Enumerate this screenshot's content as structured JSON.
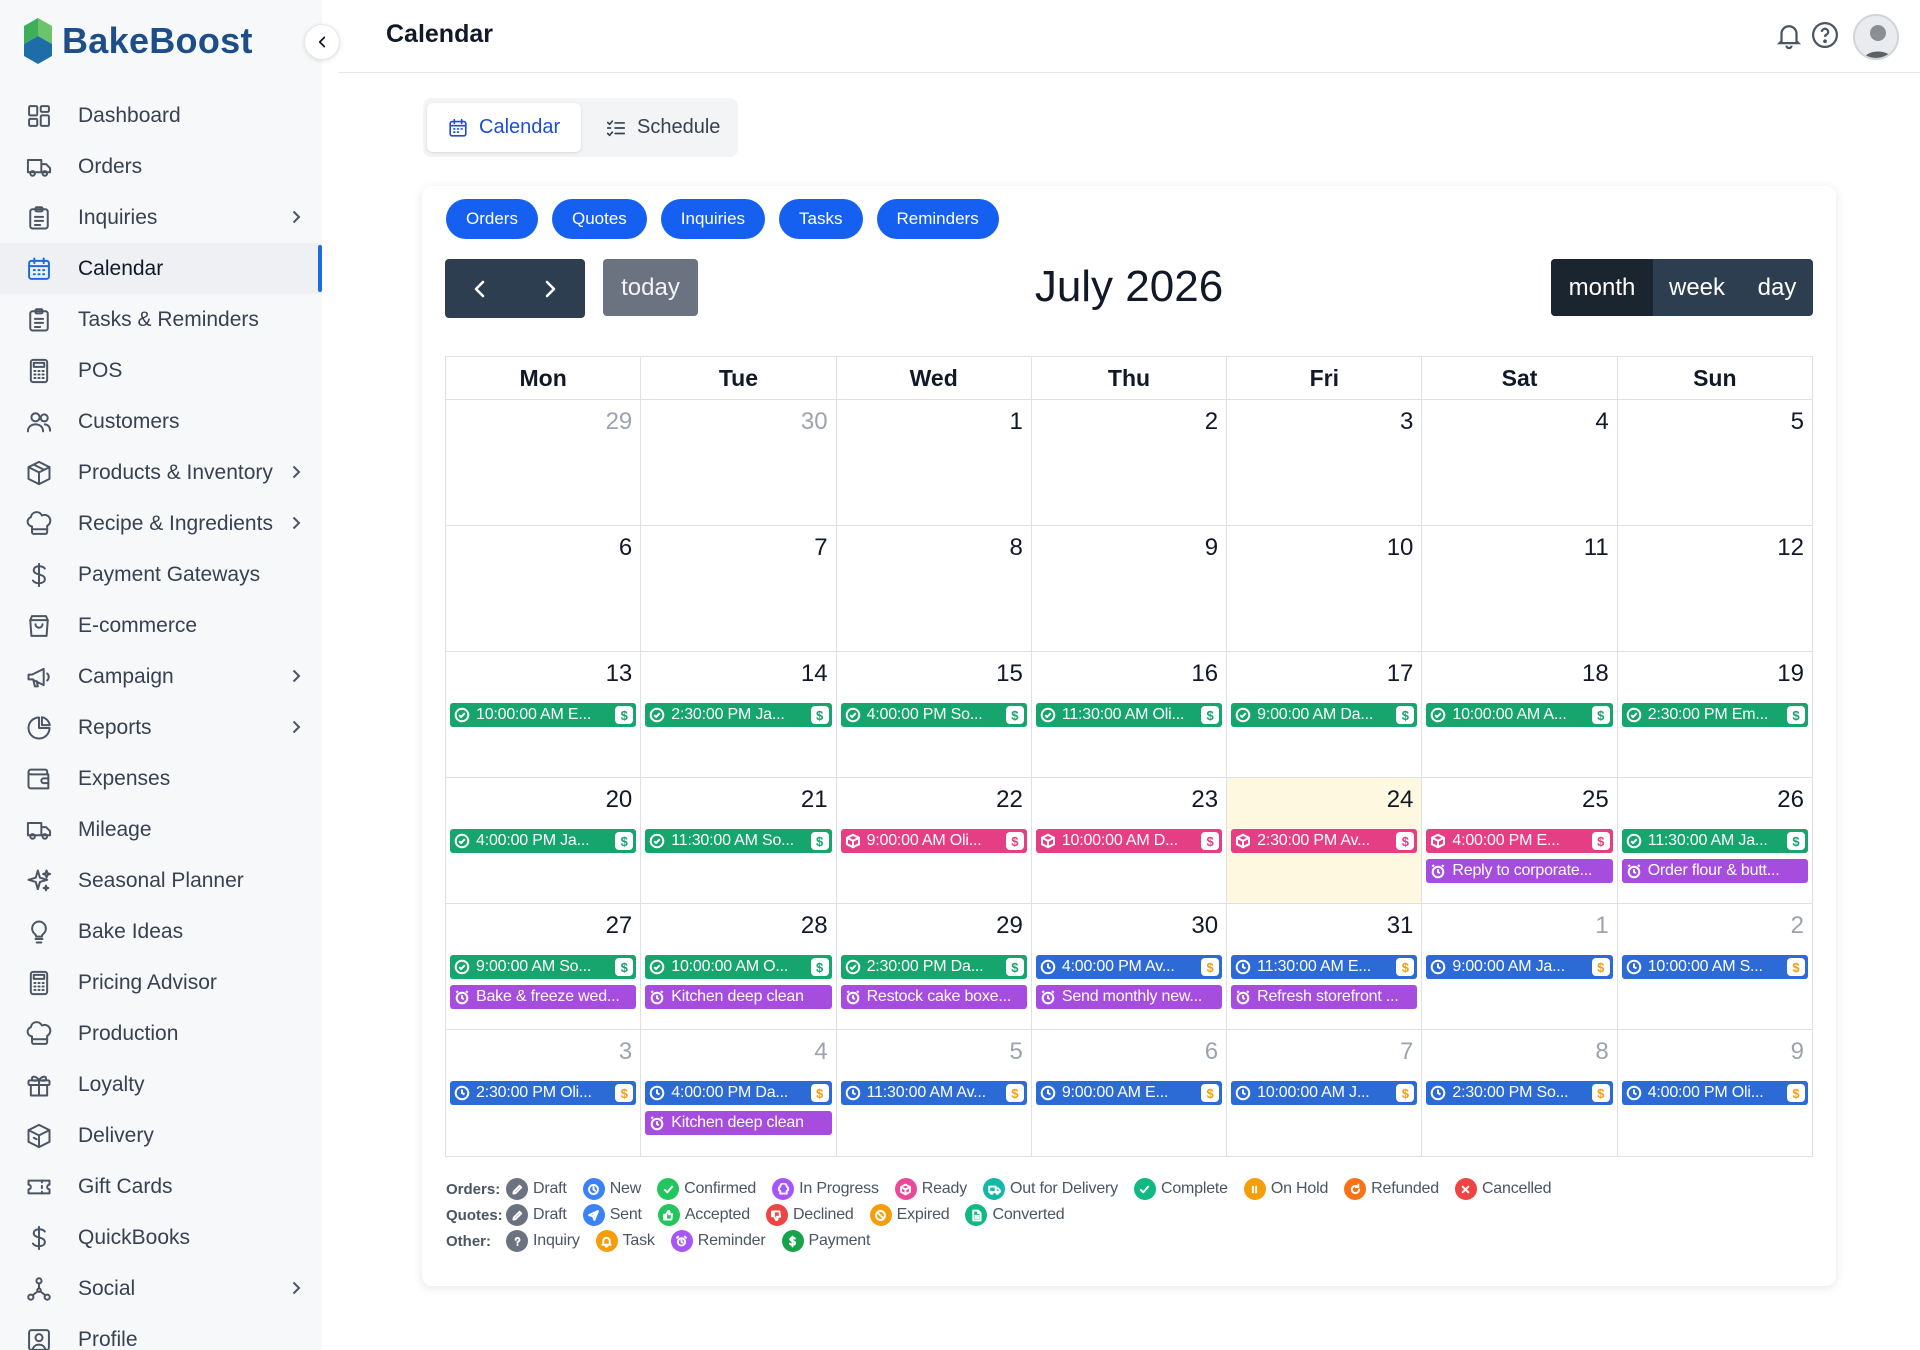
{
  "brand": {
    "name": "BakeBoost"
  },
  "header": {
    "title": "Calendar"
  },
  "sidebar": {
    "items": [
      {
        "label": "Dashboard",
        "icon": "dashboard-icon",
        "chevron": false
      },
      {
        "label": "Orders",
        "icon": "truck-icon",
        "chevron": false
      },
      {
        "label": "Inquiries",
        "icon": "clipboard-icon",
        "chevron": true
      },
      {
        "label": "Calendar",
        "icon": "calendar-icon",
        "chevron": false,
        "active": true
      },
      {
        "label": "Tasks & Reminders",
        "icon": "clipboard-icon",
        "chevron": false
      },
      {
        "label": "POS",
        "icon": "calculator-icon",
        "chevron": false
      },
      {
        "label": "Customers",
        "icon": "users-icon",
        "chevron": false
      },
      {
        "label": "Products & Inventory",
        "icon": "box-icon",
        "chevron": true
      },
      {
        "label": "Recipe & Ingredients",
        "icon": "chef-hat-icon",
        "chevron": true
      },
      {
        "label": "Payment Gateways",
        "icon": "dollar-icon",
        "chevron": false
      },
      {
        "label": "E-commerce",
        "icon": "shopping-bag-icon",
        "chevron": false
      },
      {
        "label": "Campaign",
        "icon": "megaphone-icon",
        "chevron": true
      },
      {
        "label": "Reports",
        "icon": "pie-chart-icon",
        "chevron": true
      },
      {
        "label": "Expenses",
        "icon": "wallet-icon",
        "chevron": false
      },
      {
        "label": "Mileage",
        "icon": "truck-icon",
        "chevron": false
      },
      {
        "label": "Seasonal Planner",
        "icon": "sparkles-icon",
        "chevron": false
      },
      {
        "label": "Bake Ideas",
        "icon": "lightbulb-icon",
        "chevron": false
      },
      {
        "label": "Pricing Advisor",
        "icon": "calculator-icon",
        "chevron": false
      },
      {
        "label": "Production",
        "icon": "chef-hat-icon",
        "chevron": false
      },
      {
        "label": "Loyalty",
        "icon": "gift-icon",
        "chevron": false
      },
      {
        "label": "Delivery",
        "icon": "package-icon",
        "chevron": false
      },
      {
        "label": "Gift Cards",
        "icon": "ticket-icon",
        "chevron": false
      },
      {
        "label": "QuickBooks",
        "icon": "dollar-icon",
        "chevron": false
      },
      {
        "label": "Social",
        "icon": "network-icon",
        "chevron": true
      },
      {
        "label": "Profile",
        "icon": "profile-icon",
        "chevron": false
      }
    ]
  },
  "view_tabs": {
    "calendar": "Calendar",
    "schedule": "Schedule"
  },
  "filters": [
    "Orders",
    "Quotes",
    "Inquiries",
    "Tasks",
    "Reminders"
  ],
  "toolbar": {
    "today": "today",
    "title": "July 2026",
    "month": "month",
    "week": "week",
    "day": "day"
  },
  "weekdays": [
    "Mon",
    "Tue",
    "Wed",
    "Thu",
    "Fri",
    "Sat",
    "Sun"
  ],
  "weeks": [
    [
      {
        "n": "29",
        "other": true,
        "events": []
      },
      {
        "n": "30",
        "other": true,
        "events": []
      },
      {
        "n": "1",
        "events": []
      },
      {
        "n": "2",
        "events": []
      },
      {
        "n": "3",
        "events": []
      },
      {
        "n": "4",
        "events": []
      },
      {
        "n": "5",
        "events": []
      }
    ],
    [
      {
        "n": "6",
        "events": []
      },
      {
        "n": "7",
        "events": []
      },
      {
        "n": "8",
        "events": []
      },
      {
        "n": "9",
        "events": []
      },
      {
        "n": "10",
        "events": []
      },
      {
        "n": "11",
        "events": []
      },
      {
        "n": "12",
        "events": []
      }
    ],
    [
      {
        "n": "13",
        "events": [
          {
            "text": "10:00:00 AM E...",
            "color": "green",
            "icon": "check-circle-icon",
            "pay": true
          }
        ]
      },
      {
        "n": "14",
        "events": [
          {
            "text": "2:30:00 PM Ja...",
            "color": "green",
            "icon": "check-circle-icon",
            "pay": true
          }
        ]
      },
      {
        "n": "15",
        "events": [
          {
            "text": "4:00:00 PM So...",
            "color": "green",
            "icon": "check-circle-icon",
            "pay": true
          }
        ]
      },
      {
        "n": "16",
        "events": [
          {
            "text": "11:30:00 AM Oli...",
            "color": "green",
            "icon": "check-circle-icon",
            "pay": true
          }
        ]
      },
      {
        "n": "17",
        "events": [
          {
            "text": "9:00:00 AM Da...",
            "color": "green",
            "icon": "check-circle-icon",
            "pay": true
          }
        ]
      },
      {
        "n": "18",
        "events": [
          {
            "text": "10:00:00 AM A...",
            "color": "green",
            "icon": "check-circle-icon",
            "pay": true
          }
        ]
      },
      {
        "n": "19",
        "events": [
          {
            "text": "2:30:00 PM Em...",
            "color": "green",
            "icon": "check-circle-icon",
            "pay": true
          }
        ]
      }
    ],
    [
      {
        "n": "20",
        "events": [
          {
            "text": "4:00:00 PM Ja...",
            "color": "green",
            "icon": "check-circle-icon",
            "pay": true
          }
        ]
      },
      {
        "n": "21",
        "events": [
          {
            "text": "11:30:00 AM So...",
            "color": "green",
            "icon": "check-circle-icon",
            "pay": true
          }
        ]
      },
      {
        "n": "22",
        "events": [
          {
            "text": "9:00:00 AM Oli...",
            "color": "pink",
            "icon": "box-icon",
            "pay": true
          }
        ]
      },
      {
        "n": "23",
        "events": [
          {
            "text": "10:00:00 AM D...",
            "color": "pink",
            "icon": "box-icon",
            "pay": true
          }
        ]
      },
      {
        "n": "24",
        "today": true,
        "events": [
          {
            "text": "2:30:00 PM Av...",
            "color": "pink",
            "icon": "box-icon",
            "pay": true
          }
        ]
      },
      {
        "n": "25",
        "events": [
          {
            "text": "4:00:00 PM E...",
            "color": "pink",
            "icon": "box-icon",
            "pay": true
          },
          {
            "text": "Reply to corporate...",
            "color": "purple",
            "icon": "alarm-icon",
            "pay": false
          }
        ]
      },
      {
        "n": "26",
        "events": [
          {
            "text": "11:30:00 AM Ja...",
            "color": "green",
            "icon": "check-circle-icon",
            "pay": true
          },
          {
            "text": "Order flour & butt...",
            "color": "purple",
            "icon": "alarm-icon",
            "pay": false
          }
        ]
      }
    ],
    [
      {
        "n": "27",
        "events": [
          {
            "text": "9:00:00 AM So...",
            "color": "green",
            "icon": "check-circle-icon",
            "pay": true
          },
          {
            "text": "Bake & freeze wed...",
            "color": "purple",
            "icon": "alarm-icon",
            "pay": false
          }
        ]
      },
      {
        "n": "28",
        "events": [
          {
            "text": "10:00:00 AM O...",
            "color": "green",
            "icon": "check-circle-icon",
            "pay": true
          },
          {
            "text": "Kitchen deep clean",
            "color": "purple",
            "icon": "alarm-icon",
            "pay": false
          }
        ]
      },
      {
        "n": "29",
        "events": [
          {
            "text": "2:30:00 PM Da...",
            "color": "green",
            "icon": "check-circle-icon",
            "pay": true
          },
          {
            "text": "Restock cake boxe...",
            "color": "purple",
            "icon": "alarm-icon",
            "pay": false
          }
        ]
      },
      {
        "n": "30",
        "events": [
          {
            "text": "4:00:00 PM Av...",
            "color": "blue",
            "icon": "clock-icon",
            "pay": true
          },
          {
            "text": "Send monthly new...",
            "color": "purple",
            "icon": "alarm-icon",
            "pay": false
          }
        ]
      },
      {
        "n": "31",
        "events": [
          {
            "text": "11:30:00 AM E...",
            "color": "blue",
            "icon": "clock-icon",
            "pay": true
          },
          {
            "text": "Refresh storefront ...",
            "color": "purple",
            "icon": "alarm-icon",
            "pay": false
          }
        ]
      },
      {
        "n": "1",
        "other": true,
        "events": [
          {
            "text": "9:00:00 AM Ja...",
            "color": "blue",
            "icon": "clock-icon",
            "pay": true
          }
        ]
      },
      {
        "n": "2",
        "other": true,
        "events": [
          {
            "text": "10:00:00 AM S...",
            "color": "blue",
            "icon": "clock-icon",
            "pay": true
          }
        ]
      }
    ],
    [
      {
        "n": "3",
        "other": true,
        "events": [
          {
            "text": "2:30:00 PM Oli...",
            "color": "blue",
            "icon": "clock-icon",
            "pay": true
          }
        ]
      },
      {
        "n": "4",
        "other": true,
        "events": [
          {
            "text": "4:00:00 PM Da...",
            "color": "blue",
            "icon": "clock-icon",
            "pay": true
          },
          {
            "text": "Kitchen deep clean",
            "color": "purple",
            "icon": "alarm-icon",
            "pay": false
          }
        ]
      },
      {
        "n": "5",
        "other": true,
        "events": [
          {
            "text": "11:30:00 AM Av...",
            "color": "blue",
            "icon": "clock-icon",
            "pay": true
          }
        ]
      },
      {
        "n": "6",
        "other": true,
        "events": [
          {
            "text": "9:00:00 AM E...",
            "color": "blue",
            "icon": "clock-icon",
            "pay": true
          }
        ]
      },
      {
        "n": "7",
        "other": true,
        "events": [
          {
            "text": "10:00:00 AM J...",
            "color": "blue",
            "icon": "clock-icon",
            "pay": true
          }
        ]
      },
      {
        "n": "8",
        "other": true,
        "events": [
          {
            "text": "2:30:00 PM So...",
            "color": "blue",
            "icon": "clock-icon",
            "pay": true
          }
        ]
      },
      {
        "n": "9",
        "other": true,
        "events": [
          {
            "text": "4:00:00 PM Oli...",
            "color": "blue",
            "icon": "clock-icon",
            "pay": true
          }
        ]
      }
    ]
  ],
  "legend": [
    {
      "title": "Orders:",
      "items": [
        {
          "label": "Draft",
          "color": "#6b7280",
          "icon": "pencil-icon"
        },
        {
          "label": "New",
          "color": "#3b82f6",
          "icon": "clock-icon"
        },
        {
          "label": "Confirmed",
          "color": "#22c55e",
          "icon": "check-icon"
        },
        {
          "label": "In Progress",
          "color": "#a855f7",
          "icon": "chef-hat-icon"
        },
        {
          "label": "Ready",
          "color": "#ec4899",
          "icon": "box-icon"
        },
        {
          "label": "Out for Delivery",
          "color": "#14b8a6",
          "icon": "truck-icon"
        },
        {
          "label": "Complete",
          "color": "#10b981",
          "icon": "check-icon"
        },
        {
          "label": "On Hold",
          "color": "#f59e0b",
          "icon": "pause-icon"
        },
        {
          "label": "Refunded",
          "color": "#f97316",
          "icon": "refund-icon"
        },
        {
          "label": "Cancelled",
          "color": "#ef4444",
          "icon": "x-icon"
        }
      ]
    },
    {
      "title": "Quotes:",
      "items": [
        {
          "label": "Draft",
          "color": "#6b7280",
          "icon": "pencil-icon"
        },
        {
          "label": "Sent",
          "color": "#3b82f6",
          "icon": "send-icon"
        },
        {
          "label": "Accepted",
          "color": "#22c55e",
          "icon": "thumbs-up-icon"
        },
        {
          "label": "Declined",
          "color": "#ef4444",
          "icon": "thumbs-down-icon"
        },
        {
          "label": "Expired",
          "color": "#f59e0b",
          "icon": "slash-icon"
        },
        {
          "label": "Converted",
          "color": "#10b981",
          "icon": "document-icon"
        }
      ]
    },
    {
      "title": "Other:",
      "items": [
        {
          "label": "Inquiry",
          "color": "#6b7280",
          "icon": "question-icon"
        },
        {
          "label": "Task",
          "color": "#f59e0b",
          "icon": "bell-icon"
        },
        {
          "label": "Reminder",
          "color": "#a855f7",
          "icon": "alarm-icon"
        },
        {
          "label": "Payment",
          "color": "#16a34a",
          "icon": "dollar-icon"
        }
      ]
    }
  ]
}
